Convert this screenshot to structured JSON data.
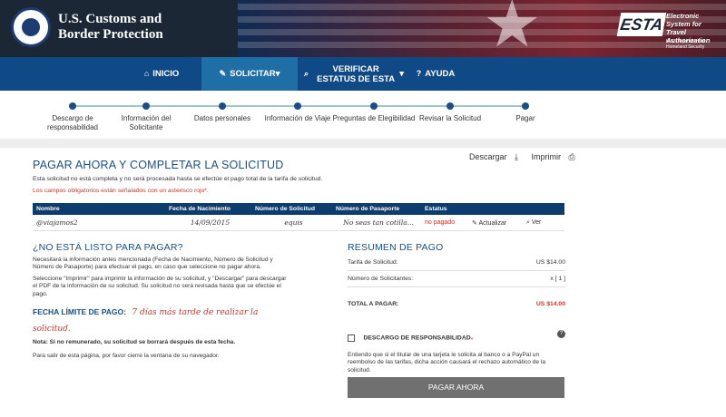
{
  "header": {
    "agency_line1": "U.S. Customs and",
    "agency_line2": "Border Protection",
    "esta_logo": "ESTA",
    "esta_name": "Electronic System for Travel Authorization",
    "esta_dept": "U.S. Department of Homeland Security"
  },
  "nav": {
    "inicio": "INICIO",
    "solicitar": "SOLICITAR",
    "verificar": "VERIFICAR ESTATUS DE ESTA",
    "ayuda": "AYUDA"
  },
  "progress": {
    "steps": [
      "Descargo de responsabilidad",
      "Información del Solicitante",
      "Datos personales",
      "Información de Viaje",
      "Preguntas de Elegibilidad",
      "Revisar la Solicitud",
      "Pagar"
    ]
  },
  "main": {
    "title": "PAGAR AHORA Y COMPLETAR LA SOLICITUD",
    "download": "Descargar",
    "print": "Imprimir",
    "subtext": "Esta solicitud no está completa y no será procesada hasta se efectúe el pago total de la tarifa de solicitud.",
    "required": "Los campos obligatorios están señalados con un asterisco rojo*."
  },
  "table": {
    "headers": [
      "Nombre",
      "Fecha de Nacimiento",
      "Número de Solicitud",
      "Número de Pasaporte",
      "Estatus",
      "",
      ""
    ],
    "row": {
      "nombre": "@viajamos2",
      "fecha": "14/09/2015",
      "solicitud": "equis",
      "pasaporte": "No seas tan cotilla...",
      "estatus": "no pagado",
      "actualizar": "Actualizar",
      "ver": "Ver"
    }
  },
  "left": {
    "heading": "¿NO ESTÁ LISTO PARA PAGAR?",
    "p1": "Necesitará la información antes mencionada (Fecha de Nacimiento, Número de Solicitud y Número de Pasaporte) para efectuar el pago, en caso que seleccione no pagar ahora.",
    "p2": "Seleccione \"Imprimir\" para imprimir la información de su solicitud, y \"Descargar\" para descargar el PDF de la información de su solicitud. Su solicitud no será revisada hasta que se efectúe el pago.",
    "deadline_label": "FECHA LÍMITE DE PAGO:",
    "deadline_hand": "7 días más tarde de realizar la solicitud.",
    "note": "Nota: Si no remunerado, su solicitud se borrará después de esta fecha.",
    "exit": "Para salir de esta página, por favor cierre la ventana de su navegador."
  },
  "summary": {
    "heading": "RESUMEN DE PAGO",
    "fee_label": "Tarifa de Solicitud:",
    "fee_value": "US $14.00",
    "count_label": "Número de Solicitantes:",
    "count_value": "x [ 1 ]",
    "total_label": "TOTAL A PAGAR:",
    "total_value": "US $14.00"
  },
  "disclaimer": {
    "label": "DESCARGO DE RESPONSABILIDAD",
    "text": "Entiendo que si el titular de una tarjeta le solicita al banco o a PayPal un reembolso de las tarifas, dicha acción causará el rechazo automático de la solicitud."
  },
  "pay_button": "PAGAR AHORA"
}
